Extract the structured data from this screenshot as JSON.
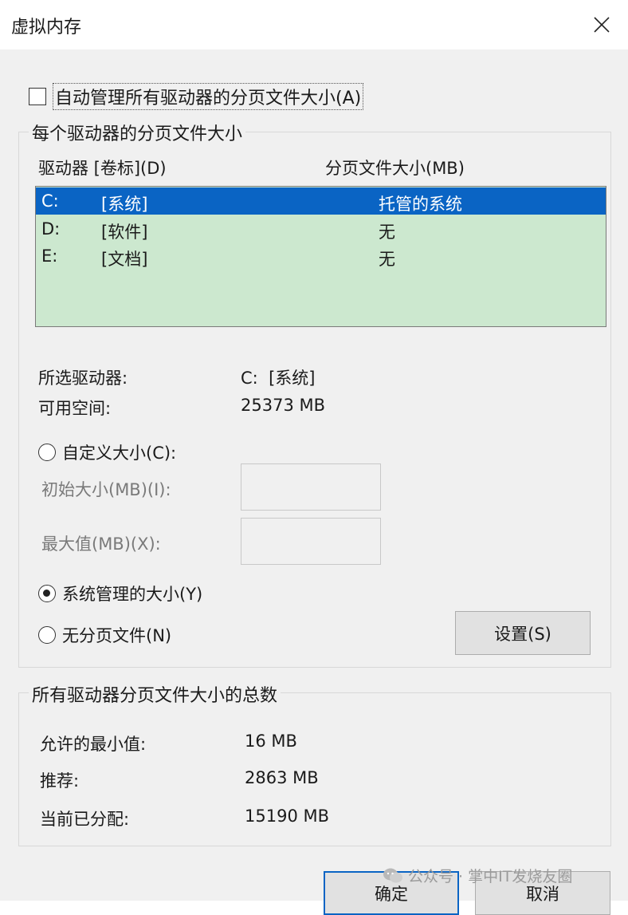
{
  "window": {
    "title": "虚拟内存",
    "close_glyph": "✕"
  },
  "auto_manage": {
    "label": "自动管理所有驱动器的分页文件大小(A)",
    "checked": false
  },
  "per_drive": {
    "group_title": "每个驱动器的分页文件大小",
    "col_drive": "驱动器 [卷标](D)",
    "col_size": "分页文件大小(MB)",
    "rows": [
      {
        "drive": "C:",
        "label": "[系统]",
        "size": "托管的系统",
        "selected": true
      },
      {
        "drive": "D:",
        "label": "[软件]",
        "size": "无",
        "selected": false
      },
      {
        "drive": "E:",
        "label": "[文档]",
        "size": "无",
        "selected": false
      }
    ],
    "selected_drive_label": "所选驱动器:",
    "selected_drive_value": "C:  [系统]",
    "free_space_label": "可用空间:",
    "free_space_value": "25373 MB",
    "custom_size_label": "自定义大小(C):",
    "initial_size_label": "初始大小(MB)(I):",
    "initial_size_value": "",
    "max_size_label": "最大值(MB)(X):",
    "max_size_value": "",
    "system_managed_label": "系统管理的大小(Y)",
    "no_paging_label": "无分页文件(N)",
    "selected_option": "system_managed",
    "set_button": "设置(S)"
  },
  "totals": {
    "group_title": "所有驱动器分页文件大小的总数",
    "min_label": "允许的最小值:",
    "min_value": "16 MB",
    "recommended_label": "推荐:",
    "recommended_value": "2863 MB",
    "current_label": "当前已分配:",
    "current_value": "15190 MB"
  },
  "buttons": {
    "ok": "确定",
    "cancel": "取消"
  },
  "watermark": {
    "text": "公众号 · 掌中IT发烧友圈",
    "icon": "wechat-icon"
  },
  "colors": {
    "selection": "#0a64c4",
    "listbox_bg": "#cce8cf",
    "dialog_bg": "#f0f0f0"
  }
}
